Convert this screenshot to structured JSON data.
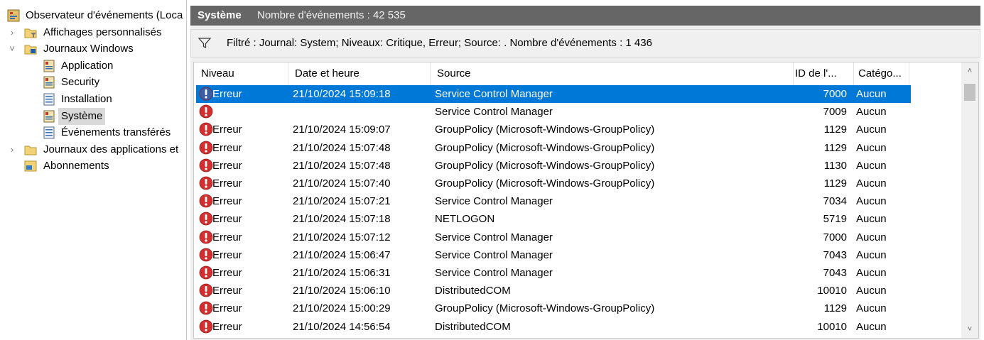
{
  "tree": {
    "items": [
      {
        "label": "Observateur d'événements (Loca",
        "chevron": "",
        "icon": "event-viewer-icon",
        "level": 0
      },
      {
        "label": "Affichages personnalisés",
        "chevron": "›",
        "icon": "folder-filter-icon",
        "level": 1
      },
      {
        "label": "Journaux Windows",
        "chevron": "˅",
        "icon": "folder-windows-icon",
        "level": 1
      },
      {
        "label": "Application",
        "chevron": "",
        "icon": "log-icon",
        "level": 2
      },
      {
        "label": "Security",
        "chevron": "",
        "icon": "log-icon",
        "level": 2
      },
      {
        "label": "Installation",
        "chevron": "",
        "icon": "log-plain-icon",
        "level": 2
      },
      {
        "label": "Système",
        "chevron": "",
        "icon": "log-icon",
        "level": 2,
        "selected": true
      },
      {
        "label": "Événements transférés",
        "chevron": "",
        "icon": "log-plain-icon",
        "level": 2
      },
      {
        "label": "Journaux des applications et",
        "chevron": "›",
        "icon": "folder-icon",
        "level": 1
      },
      {
        "label": "Abonnements",
        "chevron": "",
        "icon": "subscriptions-icon",
        "level": 1
      }
    ]
  },
  "header": {
    "title": "Système",
    "count": "Nombre d'événements : 42 535"
  },
  "filter": {
    "text": "Filtré : Journal: System; Niveaux: Critique, Erreur; Source: . Nombre d'événements : 1 436"
  },
  "table": {
    "columns": [
      "Niveau",
      "Date et heure",
      "Source",
      "ID de l'...",
      "Catégo..."
    ],
    "rows": [
      {
        "level": "Erreur",
        "date": "21/10/2024 15:09:18",
        "source": "Service Control Manager",
        "id": "7000",
        "category": "Aucun",
        "selected": true
      },
      {
        "level": "",
        "date": "",
        "source": "Service Control Manager",
        "id": "7009",
        "category": "Aucun"
      },
      {
        "level": "Erreur",
        "date": "21/10/2024 15:09:07",
        "source": "GroupPolicy (Microsoft-Windows-GroupPolicy)",
        "id": "1129",
        "category": "Aucun"
      },
      {
        "level": "Erreur",
        "date": "21/10/2024 15:07:48",
        "source": "GroupPolicy (Microsoft-Windows-GroupPolicy)",
        "id": "1129",
        "category": "Aucun"
      },
      {
        "level": "Erreur",
        "date": "21/10/2024 15:07:48",
        "source": "GroupPolicy (Microsoft-Windows-GroupPolicy)",
        "id": "1130",
        "category": "Aucun"
      },
      {
        "level": "Erreur",
        "date": "21/10/2024 15:07:40",
        "source": "GroupPolicy (Microsoft-Windows-GroupPolicy)",
        "id": "1129",
        "category": "Aucun"
      },
      {
        "level": "Erreur",
        "date": "21/10/2024 15:07:21",
        "source": "Service Control Manager",
        "id": "7034",
        "category": "Aucun"
      },
      {
        "level": "Erreur",
        "date": "21/10/2024 15:07:18",
        "source": "NETLOGON",
        "id": "5719",
        "category": "Aucun"
      },
      {
        "level": "Erreur",
        "date": "21/10/2024 15:07:12",
        "source": "Service Control Manager",
        "id": "7000",
        "category": "Aucun"
      },
      {
        "level": "Erreur",
        "date": "21/10/2024 15:06:47",
        "source": "Service Control Manager",
        "id": "7043",
        "category": "Aucun"
      },
      {
        "level": "Erreur",
        "date": "21/10/2024 15:06:31",
        "source": "Service Control Manager",
        "id": "7043",
        "category": "Aucun"
      },
      {
        "level": "Erreur",
        "date": "21/10/2024 15:06:10",
        "source": "DistributedCOM",
        "id": "10010",
        "category": "Aucun"
      },
      {
        "level": "Erreur",
        "date": "21/10/2024 15:00:29",
        "source": "GroupPolicy (Microsoft-Windows-GroupPolicy)",
        "id": "1129",
        "category": "Aucun"
      },
      {
        "level": "Erreur",
        "date": "21/10/2024 14:56:54",
        "source": "DistributedCOM",
        "id": "10010",
        "category": "Aucun"
      }
    ]
  },
  "colors": {
    "selection": "#0078d7",
    "error": "#d32f2f",
    "header_bg": "#666666"
  }
}
